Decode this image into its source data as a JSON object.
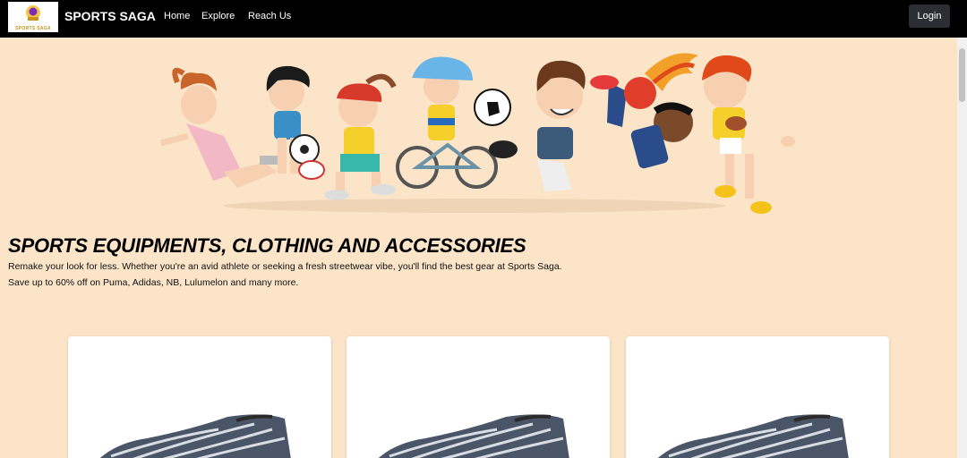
{
  "nav": {
    "logo_text": "SPORTS SAGA",
    "brand": "SPORTS SAGA",
    "links": [
      "Home",
      "Explore",
      "Reach Us"
    ],
    "login": "Login"
  },
  "hero": {
    "title": "SPORTS EQUIPMENTS, CLOTHING AND ACCESSORIES",
    "line1": "Remake your look for less. Whether you're an avid athlete or seeking a fresh streetwear vibe, you'll find the best gear at Sports Saga.",
    "line2": "Save up to 60% off on Puma, Adidas, NB, Lulumelon and many more."
  },
  "products": [
    {
      "icon": "shoe-image"
    },
    {
      "icon": "shoe-image"
    },
    {
      "icon": "shoe-image"
    }
  ]
}
